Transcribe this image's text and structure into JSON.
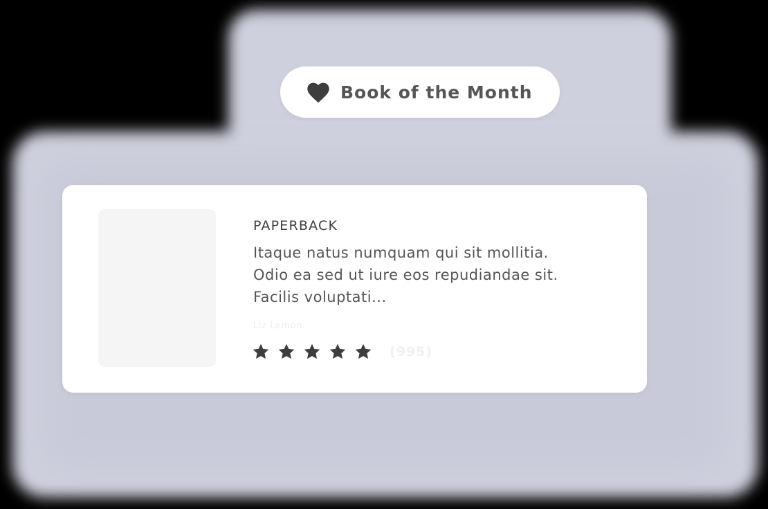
{
  "badge": {
    "icon": "heart-icon",
    "label": "Book of the Month"
  },
  "product": {
    "format": "PAPERBACK",
    "description_lines": [
      "Itaque natus numquam qui sit mollitia.",
      "Odio ea sed ut iure eos repudiandae sit.",
      "Facilis voluptati..."
    ],
    "author": "Liz Lemon",
    "rating": {
      "stars_filled": 5,
      "stars_total": 5,
      "review_count": "(995)"
    }
  },
  "colors": {
    "background": "#000000",
    "glow": "#cfd0de",
    "card": "#ffffff",
    "icon": "#3d3d3d",
    "text": "#555555"
  }
}
